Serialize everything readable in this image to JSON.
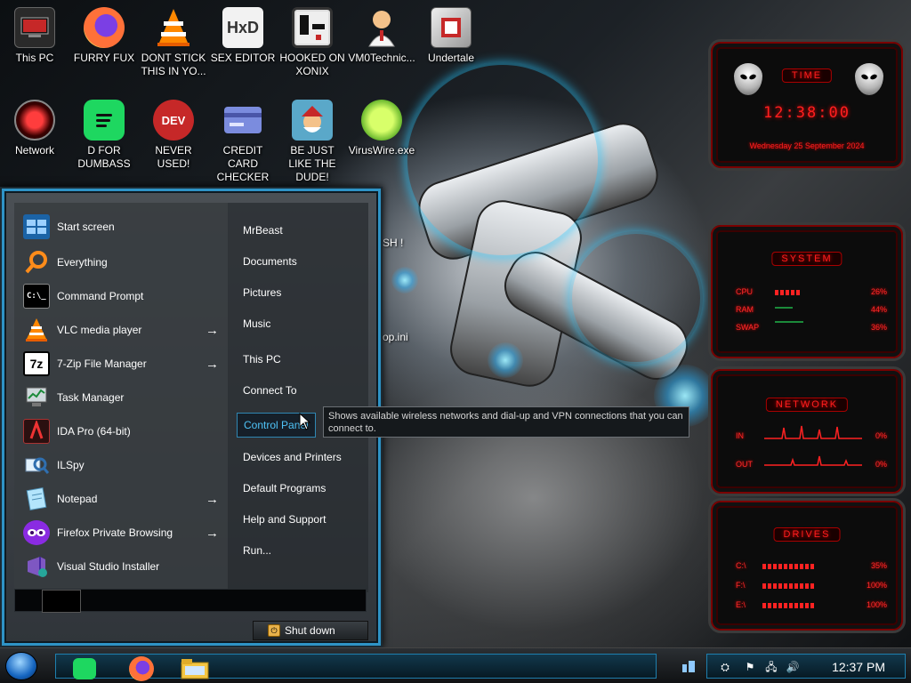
{
  "desktop": {
    "icons": [
      {
        "label": "This PC",
        "icon": "this-pc-icon"
      },
      {
        "label": "FURRY FUX",
        "icon": "firefox-icon"
      },
      {
        "label": "DONT STICK THIS IN YO...",
        "icon": "vlc-cone-icon"
      },
      {
        "label": "SEX EDITOR",
        "icon": "hxd-editor-icon"
      },
      {
        "label": "HOOKED ON XONIX",
        "icon": "xonix-game-icon"
      },
      {
        "label": "VM0Technic...",
        "icon": "person-icon"
      },
      {
        "label": "Undertale",
        "icon": "undertale-icon"
      },
      {
        "label": "Network",
        "icon": "network-icon"
      },
      {
        "label": "D FOR DUMBASS",
        "icon": "spotify-icon"
      },
      {
        "label": "NEVER USED!",
        "icon": "devcpp-icon"
      },
      {
        "label": "CREDIT CARD CHECKER",
        "icon": "credit-card-icon"
      },
      {
        "label": "BE JUST LIKE THE DUDE!",
        "icon": "santa-icon"
      },
      {
        "label": "VirusWire.exe",
        "icon": "lime-icon"
      }
    ],
    "partial_labels": [
      "SH !",
      "op.ini"
    ]
  },
  "start_menu": {
    "programs": [
      {
        "label": "Start screen",
        "icon": "start-screen-icon",
        "submenu": false
      },
      {
        "label": "Everything",
        "icon": "search-icon",
        "submenu": false
      },
      {
        "label": "Command Prompt",
        "icon": "cmd-icon",
        "submenu": false
      },
      {
        "label": "VLC media player",
        "icon": "vlc-icon",
        "submenu": true
      },
      {
        "label": "7-Zip File Manager",
        "icon": "7zip-icon",
        "submenu": true
      },
      {
        "label": "Task Manager",
        "icon": "task-manager-icon",
        "submenu": false
      },
      {
        "label": "IDA Pro (64-bit)",
        "icon": "ida-icon",
        "submenu": false
      },
      {
        "label": "ILSpy",
        "icon": "ilspy-icon",
        "submenu": false
      },
      {
        "label": "Notepad",
        "icon": "notepad-icon",
        "submenu": true
      },
      {
        "label": "Firefox Private Browsing",
        "icon": "firefox-private-icon",
        "submenu": true
      },
      {
        "label": "Visual Studio Installer",
        "icon": "vs-installer-icon",
        "submenu": false
      }
    ],
    "arrow": "→",
    "places": [
      "MrBeast",
      "Documents",
      "Pictures",
      "Music",
      "This PC",
      "Connect To",
      "Control Panel",
      "Devices and Printers",
      "Default Programs",
      "Help and Support",
      "Run..."
    ],
    "highlighted_place": "Control Panel",
    "shutdown_label": "Shut down"
  },
  "tooltip": {
    "text": "Shows available wireless networks and dial-up and VPN connections that you can connect to."
  },
  "gadgets": {
    "time": {
      "title": "TIME",
      "clock": "12:38:00",
      "date": "Wednesday 25 September 2024"
    },
    "system": {
      "title": "SYSTEM",
      "rows": [
        {
          "label": "CPU",
          "value": "26%",
          "level": 0.26
        },
        {
          "label": "RAM",
          "value": "44%",
          "level": 0.44
        },
        {
          "label": "SWAP",
          "value": "36%",
          "level": 0.36
        }
      ]
    },
    "network": {
      "title": "NETWORK",
      "rows": [
        {
          "label": "IN",
          "value": "0%"
        },
        {
          "label": "OUT",
          "value": "0%"
        }
      ]
    },
    "drives": {
      "title": "DRIVES",
      "rows": [
        {
          "label": "C:\\",
          "value": "35%",
          "level": 0.35
        },
        {
          "label": "F:\\",
          "value": "100%",
          "level": 1.0
        },
        {
          "label": "E:\\",
          "value": "100%",
          "level": 1.0
        }
      ]
    },
    "accent_color": "#ff1f1f"
  },
  "taskbar": {
    "pinned": [
      "spotify-icon",
      "firefox-icon",
      "file-explorer-icon"
    ],
    "clock": "12:37 PM",
    "accent_color": "#1e7fae"
  }
}
